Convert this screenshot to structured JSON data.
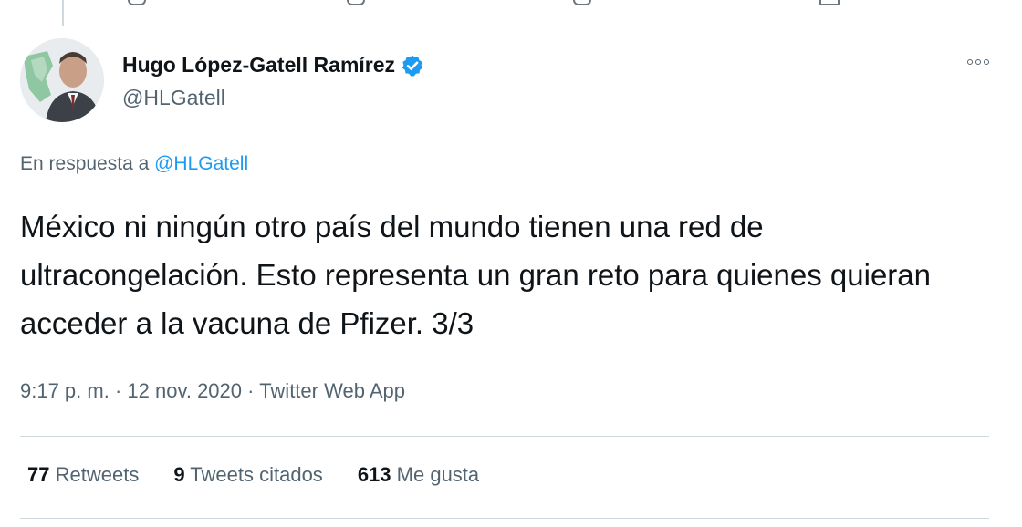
{
  "author": {
    "display_name": "Hugo López-Gatell Ramírez",
    "handle": "@HLGatell",
    "verified": true
  },
  "reply": {
    "prefix": "En respuesta a",
    "mention": "@HLGatell"
  },
  "tweet": {
    "text": "México ni ningún otro país del mundo tienen una red de ultracongelación. Esto representa un gran reto para quienes quieran acceder a la vacuna de Pfizer. 3/3"
  },
  "meta": {
    "time": "9:17 p. m.",
    "date": "12 nov. 2020",
    "source": "Twitter Web App",
    "separator": "·"
  },
  "stats": {
    "retweets": {
      "count": "77",
      "label": "Retweets"
    },
    "quotes": {
      "count": "9",
      "label": "Tweets citados"
    },
    "likes": {
      "count": "613",
      "label": "Me gusta"
    }
  },
  "colors": {
    "accent": "#1d9bf0",
    "text": "#0f1419",
    "muted": "#536471",
    "divider": "#cfd9de"
  }
}
